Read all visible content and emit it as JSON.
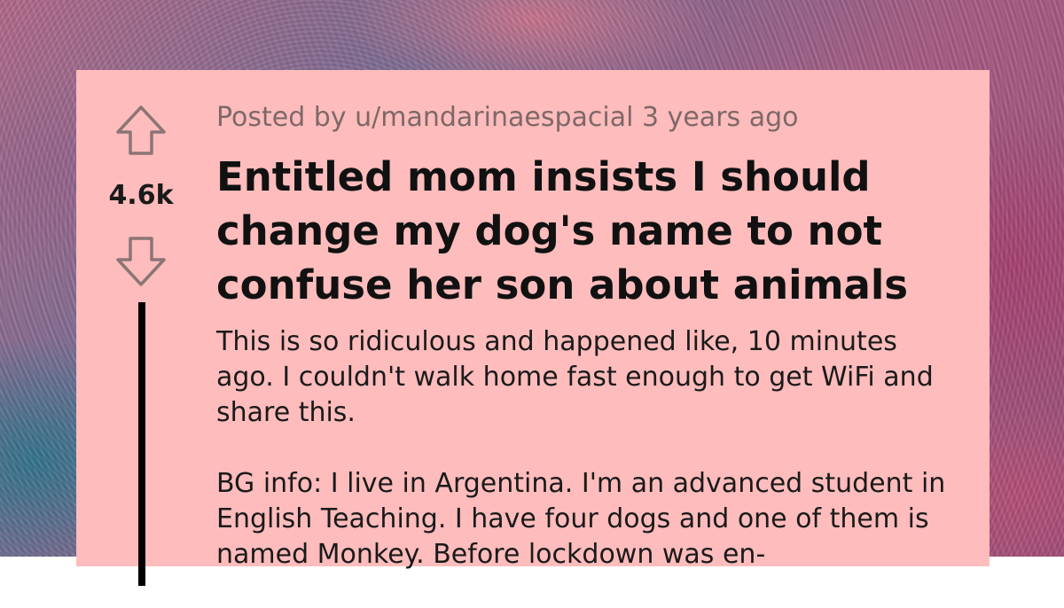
{
  "post": {
    "meta": "Posted by u/mandarinaespacial 3 years ago",
    "score": "4.6k",
    "title": "Entitled mom insists I should change my dog's name to not confuse her son about animals",
    "paragraphs": [
      "This is so ridiculous and happened like, 10 minutes ago. I couldn't walk home fast enough to get WiFi and share this.",
      "BG info: I live in Argentina. I'm an advanced student in English Teaching. I have four dogs and one of them is named Monkey. Before lockdown was en-"
    ]
  },
  "icons": {
    "upvote": "upvote-arrow-icon",
    "downvote": "downvote-arrow-icon"
  },
  "colors": {
    "card_background": "#ffbcbc",
    "meta_text": "#7e6868",
    "title_text": "#111111",
    "thread_line": "#000000"
  }
}
